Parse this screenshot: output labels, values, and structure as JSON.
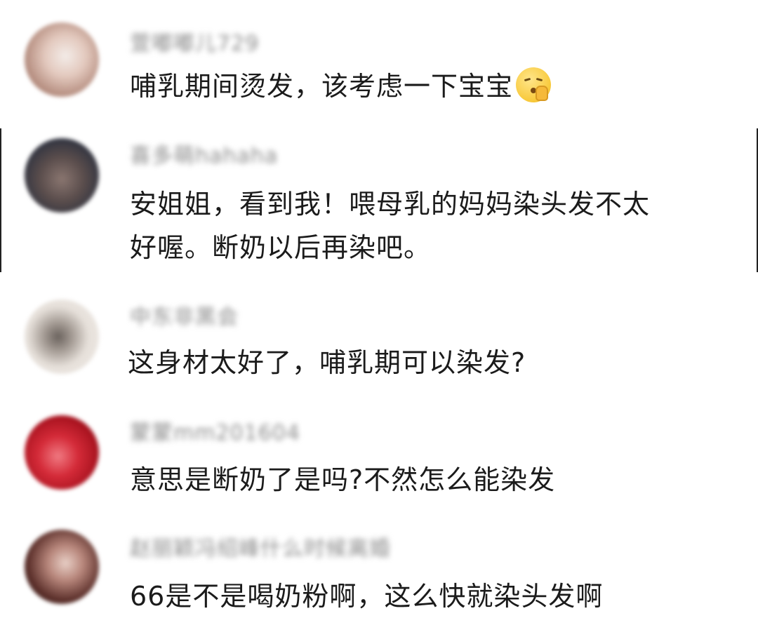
{
  "comments": [
    {
      "username": "萱嘟嘟儿729",
      "text": "哺乳期间烫发，该考虑一下宝宝",
      "emoji": "shushing-face-icon",
      "avatar_colors": [
        "#e9d6cf",
        "#b48c7e",
        "#f3ece8"
      ]
    },
    {
      "username": "喜多萌hahaha",
      "text_lines": [
        "安姐姐，看到我！喂母乳的妈妈染头发不太",
        "好喔。断奶以后再染吧。"
      ],
      "avatar_colors": [
        "#3b3f4c",
        "#6d5a55",
        "#c9b7b0"
      ]
    },
    {
      "username": "中东非黑会",
      "text": "这身材太好了，哺乳期可以染发?",
      "avatar_colors": [
        "#ece7e2",
        "#4a4440",
        "#d3cbc4"
      ]
    },
    {
      "username": "蒙蒙mm201604",
      "text": "意思是断奶了是吗?不然怎么能染发",
      "avatar_colors": [
        "#c81d2a",
        "#8a0d16",
        "#e8535d"
      ]
    },
    {
      "username": "赵丽颖冯绍峰什么时候离婚",
      "text": "66是不是喝奶粉啊，这么快就染头发啊",
      "avatar_colors": [
        "#5b2f2a",
        "#c9a49a",
        "#2a1c1a"
      ]
    }
  ]
}
